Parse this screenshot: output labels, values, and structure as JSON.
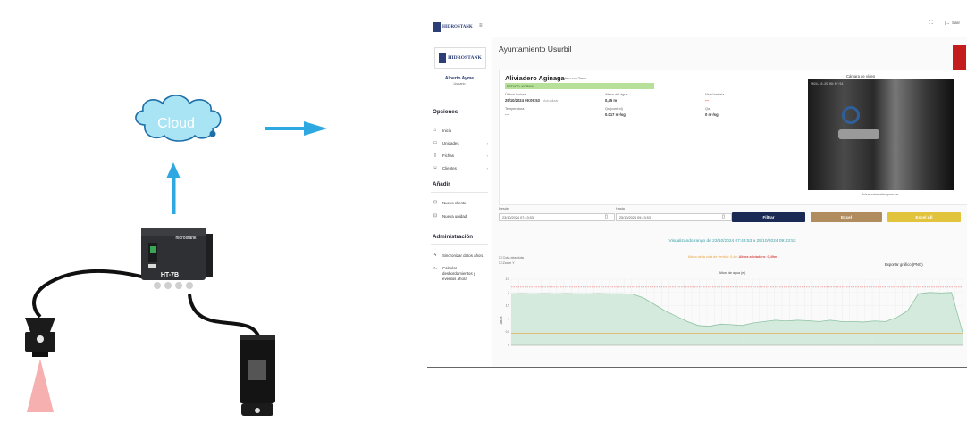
{
  "illustration": {
    "cloud_label": "Cloud",
    "device_brand": "hidrostank",
    "device_model": "HT-7B"
  },
  "colors": {
    "arrow": "#2ea8e0",
    "cloud_fill": "#a8e4f4",
    "cloud_stroke": "#1e6fa8",
    "beam": "#f6b0b0",
    "navy": "#1b2a55",
    "gold": "#e2c33c",
    "tan": "#b08c5e",
    "area_fill": "#cfe8d8",
    "area_line": "#8ec3a4",
    "threshold_red": "#d9534f",
    "threshold_orange": "#e8a33d"
  },
  "app": {
    "logo_text": "HIDROSTANK",
    "sidebar": {
      "user_name": "Alberto Ayme",
      "user_role": "Usuario",
      "options_heading": "Opciones",
      "items": [
        {
          "label": "Inicio",
          "icon": "home-icon"
        },
        {
          "label": "Unidades",
          "icon": "monitor-icon"
        },
        {
          "label": "Fichas",
          "icon": "file-icon"
        },
        {
          "label": "Clientes",
          "icon": "users-icon"
        }
      ],
      "add_heading": "Añadir",
      "add_items": [
        {
          "label": "Nuevo cliente"
        },
        {
          "label": "Nueva unidad"
        }
      ],
      "admin_heading": "Administración",
      "admin_items": [
        {
          "label": "Sincronizar datos ahora"
        },
        {
          "label": "Calcular desbordamientos y eventos ahora"
        }
      ]
    },
    "topbar": {
      "exit_label": "Salir"
    },
    "page_title": "Ayuntamiento Usurbil",
    "unit": {
      "name": "Aliviadero Aginaga",
      "subtitle": "Aliviadero con Tanto",
      "status": "ESTADO: NORMAL",
      "fields": [
        {
          "label": "Última lectura",
          "value": "25/10/2024 09:09:53",
          "note": "Actualizar"
        },
        {
          "label": "Altura del agua",
          "value": "0,45 m"
        },
        {
          "label": "Nivel batería",
          "value": "---"
        },
        {
          "label": "Temperatura",
          "value": "---"
        },
        {
          "label": "Qs (control)",
          "value": "0.017 m³/sg"
        },
        {
          "label": "Qa",
          "value": "0 m³/sg"
        }
      ],
      "camera_title": "Cámara de vídeo",
      "camera_caption": "Pulsar sobre video para ver",
      "camera_timestamp": "2024-10-25 09:07:54"
    },
    "filters": {
      "from_label": "Desde",
      "from_value": "23/10/2024 07:43:53",
      "to_label": "Hasta",
      "to_value": "25/10/2024 09:43:53",
      "filter_button": "Filtrar",
      "excel_button": "Excel",
      "excel_all_button": "Excel All"
    },
    "chart_section": {
      "range_text": "Visualizando rango de 23/10/2024 07:43:53 a 25/10/2024 09:43:53",
      "threshold_text_orange": "Altura de la cota de vertido: 0,4m",
      "threshold_text_red": "Altura aliviadero: 0,49m",
      "checkbox_1": "Cota absoluta",
      "checkbox_2": "Zoom Y",
      "export_label": "Exportar gráfico (PNG)",
      "chart_title": "Altura de agua (m)",
      "ylabel": "Altura"
    }
  },
  "chart_data": {
    "type": "area",
    "title": "Altura de agua (m)",
    "xlabel": "",
    "ylabel": "Altura",
    "ylim": [
      0,
      2.5
    ],
    "y_ticks": [
      "0",
      "0.5",
      "1",
      "1.5",
      "2",
      "2.5"
    ],
    "series": [
      {
        "values": [
          1.95,
          1.96,
          1.95,
          1.96,
          1.95,
          1.96,
          1.95,
          1.95,
          1.96,
          1.95,
          1.95,
          1.94,
          1.8,
          1.55,
          1.3,
          1.1,
          0.9,
          0.75,
          0.72,
          0.8,
          0.78,
          0.75,
          0.85,
          0.9,
          0.95,
          0.92,
          0.95,
          0.93,
          0.9,
          0.95,
          0.9,
          0.9,
          0.88,
          0.92,
          0.9,
          1.05,
          1.3,
          1.95,
          2.0,
          1.98,
          2.0,
          0.5
        ]
      }
    ],
    "thresholds": [
      {
        "value": 2.2,
        "color": "red"
      },
      {
        "value": 1.95,
        "color": "red"
      },
      {
        "value": 0.45,
        "color": "orange"
      }
    ]
  }
}
